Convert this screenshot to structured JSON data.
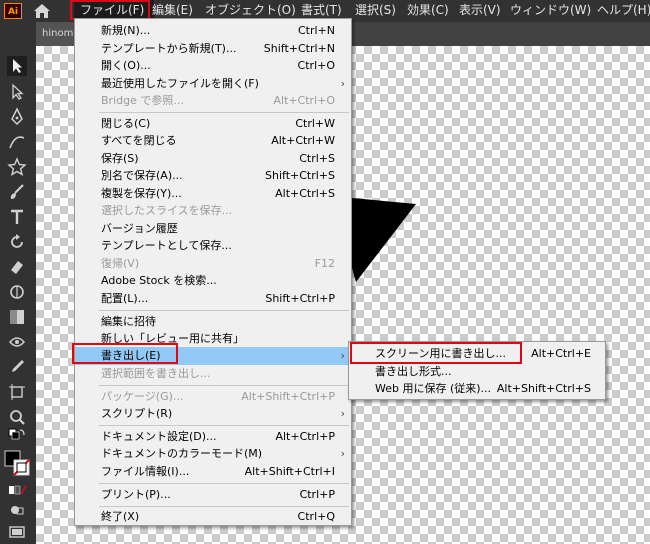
{
  "app": {
    "logo_text": "Ai",
    "accent": "#ff9a00"
  },
  "menubar": {
    "items": [
      {
        "label": "ファイル(F)"
      },
      {
        "label": "編集(E)"
      },
      {
        "label": "オブジェクト(O)"
      },
      {
        "label": "書式(T)"
      },
      {
        "label": "選択(S)"
      },
      {
        "label": "効果(C)"
      },
      {
        "label": "表示(V)"
      },
      {
        "label": "ウィンドウ(W)"
      },
      {
        "label": "ヘルプ(H)"
      }
    ]
  },
  "document_tab": {
    "title": "hinoma"
  },
  "file_menu": {
    "items": [
      {
        "label": "新規(N)...",
        "shortcut": "Ctrl+N"
      },
      {
        "label": "テンプレートから新規(T)...",
        "shortcut": "Shift+Ctrl+N"
      },
      {
        "label": "開く(O)...",
        "shortcut": "Ctrl+O"
      },
      {
        "label": "最近使用したファイルを開く(F)",
        "arrow": "›"
      },
      {
        "label": "Bridge で参照...",
        "shortcut": "Alt+Ctrl+O",
        "disabled": true
      },
      {
        "label": "閉じる(C)",
        "shortcut": "Ctrl+W"
      },
      {
        "label": "すべてを閉じる",
        "shortcut": "Alt+Ctrl+W"
      },
      {
        "label": "保存(S)",
        "shortcut": "Ctrl+S"
      },
      {
        "label": "別名で保存(A)...",
        "shortcut": "Shift+Ctrl+S"
      },
      {
        "label": "複製を保存(Y)...",
        "shortcut": "Alt+Ctrl+S"
      },
      {
        "label": "選択したスライスを保存...",
        "disabled": true
      },
      {
        "label": "バージョン履歴"
      },
      {
        "label": "テンプレートとして保存..."
      },
      {
        "label": "復帰(V)",
        "shortcut": "F12",
        "disabled": true
      },
      {
        "label": "Adobe Stock を検索..."
      },
      {
        "label": "配置(L)...",
        "shortcut": "Shift+Ctrl+P"
      },
      {
        "label": "編集に招待"
      },
      {
        "label": "新しい「レビュー用に共有」"
      },
      {
        "label": "書き出し(E)",
        "arrow": "›"
      },
      {
        "label": "選択範囲を書き出し...",
        "disabled": true
      },
      {
        "label": "パッケージ(G)...",
        "shortcut": "Alt+Shift+Ctrl+P",
        "disabled": true
      },
      {
        "label": "スクリプト(R)",
        "arrow": "›"
      },
      {
        "label": "ドキュメント設定(D)...",
        "shortcut": "Alt+Ctrl+P"
      },
      {
        "label": "ドキュメントのカラーモード(M)",
        "arrow": "›"
      },
      {
        "label": "ファイル情報(I)...",
        "shortcut": "Alt+Shift+Ctrl+I"
      },
      {
        "label": "プリント(P)...",
        "shortcut": "Ctrl+P"
      },
      {
        "label": "終了(X)",
        "shortcut": "Ctrl+Q"
      }
    ]
  },
  "export_submenu": {
    "items": [
      {
        "label": "スクリーン用に書き出し...",
        "shortcut": "Alt+Ctrl+E"
      },
      {
        "label": "書き出し形式..."
      },
      {
        "label": "Web 用に保存 (従来)...",
        "shortcut": "Alt+Shift+Ctrl+S"
      }
    ]
  },
  "colors": {
    "highlight": "#91c9f7",
    "callout": "#e10614",
    "menu_bg": "#f0f0f0"
  }
}
